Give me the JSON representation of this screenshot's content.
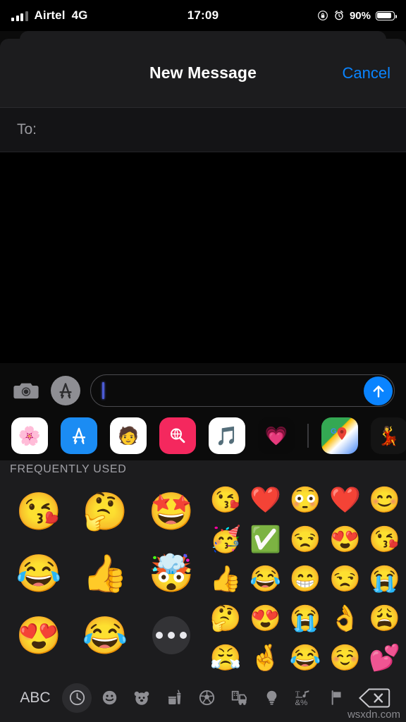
{
  "status_bar": {
    "carrier": "Airtel",
    "network": "4G",
    "time": "17:09",
    "battery_percent": "90%",
    "battery_level": 90,
    "icons": [
      "signal-bars-icon",
      "rotation-lock-icon",
      "alarm-clock-icon",
      "battery-icon"
    ]
  },
  "nav": {
    "title": "New Message",
    "cancel_label": "Cancel",
    "accent_color": "#0a84ff"
  },
  "recipient": {
    "label": "To:",
    "value": "",
    "placeholder": ""
  },
  "compose": {
    "camera_icon": "camera-icon",
    "appstore_icon": "app-store-icon",
    "message_value": "",
    "message_placeholder": "",
    "send_icon": "send-arrow-up-icon",
    "send_color": "#0a84ff"
  },
  "app_drawer": {
    "apps": [
      {
        "name": "photos-app",
        "glyph": "🌼",
        "bg": "#ffffff"
      },
      {
        "name": "app-store-app",
        "glyph": "",
        "bg": "#1b8cf3"
      },
      {
        "name": "memoji-stickers-app",
        "glyph": "👩",
        "bg": "#ffffff"
      },
      {
        "name": "images-search-app",
        "glyph": "🔎",
        "bg": "#f4285e"
      },
      {
        "name": "music-app",
        "glyph": "🎵",
        "bg": "#ffffff"
      },
      {
        "name": "digital-touch-app",
        "glyph": "💗",
        "bg": "#000000"
      },
      {
        "name": "google-maps-app",
        "glyph": "📍",
        "bg": "#34a853"
      },
      {
        "name": "pink-sticker-app",
        "glyph": "💄",
        "bg": "#1a1a1a"
      }
    ]
  },
  "emoji_panel": {
    "section_title": "FREQUENTLY USED",
    "memoji": [
      {
        "name": "memoji-kiss-heart",
        "glyph": "😘"
      },
      {
        "name": "memoji-thinking",
        "glyph": "🤔"
      },
      {
        "name": "memoji-star-struck",
        "glyph": "🤩"
      },
      {
        "name": "memoji-laughing-tears",
        "glyph": "😂"
      },
      {
        "name": "memoji-thumbs-up",
        "glyph": "👍"
      },
      {
        "name": "memoji-mind-blown",
        "glyph": "🤯"
      },
      {
        "name": "memoji-heart-eyes",
        "glyph": "😍"
      },
      {
        "name": "memoji-crying-laughing",
        "glyph": "😂"
      }
    ],
    "more_button": "more-stickers-button",
    "emoji": [
      {
        "name": "emoji-face-blowing-kiss",
        "glyph": "😘"
      },
      {
        "name": "emoji-red-heart",
        "glyph": "❤️"
      },
      {
        "name": "emoji-flushed-face",
        "glyph": "😳"
      },
      {
        "name": "emoji-red-heart",
        "glyph": "❤️"
      },
      {
        "name": "emoji-smiling-face",
        "glyph": "😊"
      },
      {
        "name": "emoji-partying-face",
        "glyph": "🥳"
      },
      {
        "name": "emoji-check-mark-button",
        "glyph": "✅"
      },
      {
        "name": "emoji-unamused-face",
        "glyph": "😒"
      },
      {
        "name": "emoji-smiling-face-heart-eyes",
        "glyph": "😍"
      },
      {
        "name": "emoji-face-blowing-kiss",
        "glyph": "😘"
      },
      {
        "name": "emoji-thumbs-up",
        "glyph": "👍"
      },
      {
        "name": "emoji-face-with-tears-of-joy",
        "glyph": "😂"
      },
      {
        "name": "emoji-beaming-face",
        "glyph": "😁"
      },
      {
        "name": "emoji-unamused-face",
        "glyph": "😒"
      },
      {
        "name": "emoji-loudly-crying-face",
        "glyph": "😭"
      },
      {
        "name": "emoji-thinking-face",
        "glyph": "🤔"
      },
      {
        "name": "emoji-smiling-face-heart-eyes",
        "glyph": "😍"
      },
      {
        "name": "emoji-loudly-crying-face",
        "glyph": "😭"
      },
      {
        "name": "emoji-ok-hand",
        "glyph": "👌"
      },
      {
        "name": "emoji-weary-face",
        "glyph": "😩"
      },
      {
        "name": "emoji-face-with-steam-from-nose",
        "glyph": "😤"
      },
      {
        "name": "emoji-crossed-fingers",
        "glyph": "🤞"
      },
      {
        "name": "emoji-face-with-tears-of-joy",
        "glyph": "😂"
      },
      {
        "name": "emoji-upside-down-face",
        "glyph": "☺️"
      },
      {
        "name": "emoji-two-hearts",
        "glyph": "💕"
      }
    ]
  },
  "keyboard_bar": {
    "abc_label": "ABC",
    "categories": [
      {
        "name": "category-recents-icon",
        "glyph": "🕒",
        "selected": true
      },
      {
        "name": "category-smileys-icon",
        "glyph": "😀",
        "selected": false
      },
      {
        "name": "category-animals-icon",
        "glyph": "🐻",
        "selected": false
      },
      {
        "name": "category-food-icon",
        "glyph": "🍔",
        "selected": false
      },
      {
        "name": "category-activity-icon",
        "glyph": "⚽",
        "selected": false
      },
      {
        "name": "category-travel-icon",
        "glyph": "🚗",
        "selected": false
      },
      {
        "name": "category-objects-icon",
        "glyph": "💡",
        "selected": false
      },
      {
        "name": "category-symbols-icon",
        "glyph": "&%",
        "selected": false
      },
      {
        "name": "category-flags-icon",
        "glyph": "🏳",
        "selected": false
      }
    ],
    "delete_icon": "delete-backspace-icon"
  },
  "watermark": "wsxdn.com"
}
